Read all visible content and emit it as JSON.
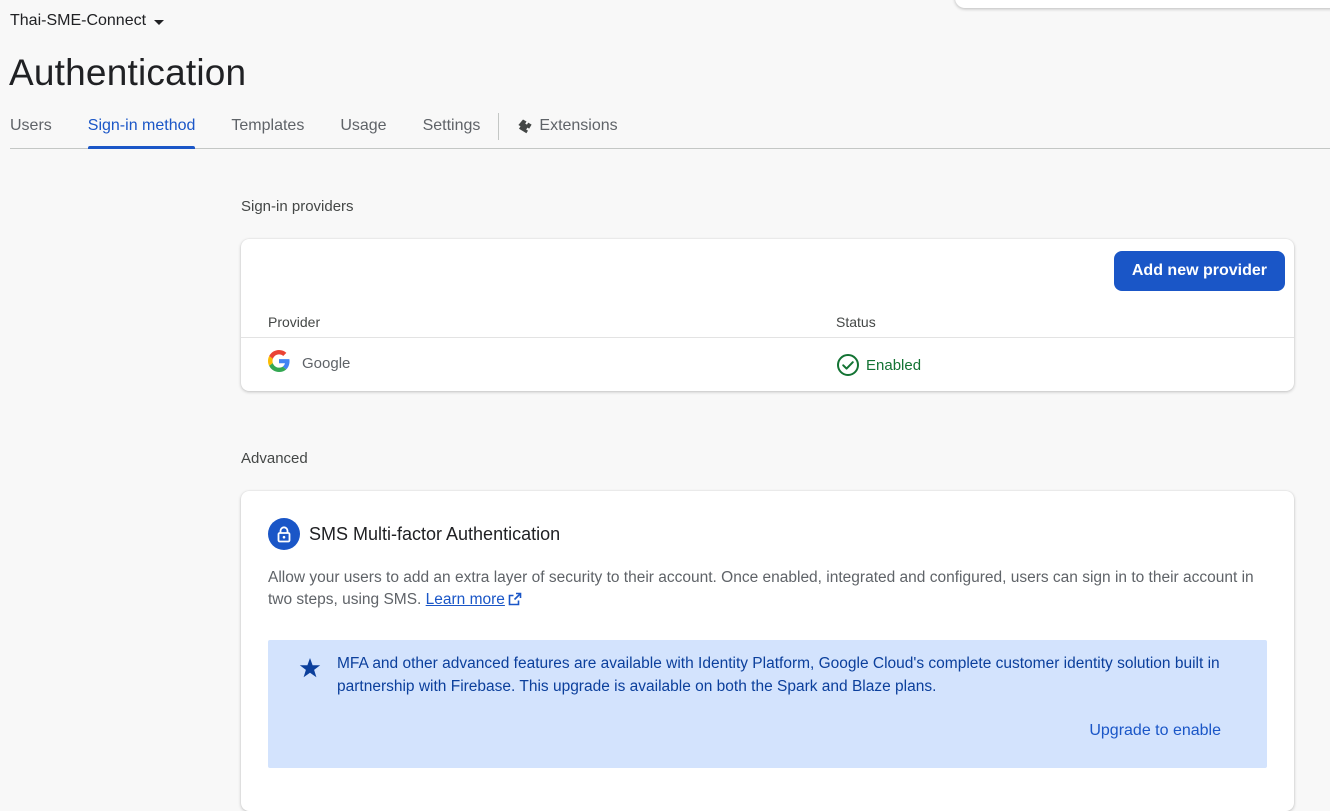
{
  "project": {
    "name": "Thai-SME-Connect"
  },
  "page": {
    "title": "Authentication"
  },
  "tabs": [
    {
      "label": "Users"
    },
    {
      "label": "Sign-in method"
    },
    {
      "label": "Templates"
    },
    {
      "label": "Usage"
    },
    {
      "label": "Settings"
    },
    {
      "label": "Extensions",
      "icon": "extension-icon"
    }
  ],
  "active_tab": "Sign-in method",
  "sign_in_providers": {
    "section_label": "Sign-in providers",
    "add_button": "Add new provider",
    "columns": {
      "provider": "Provider",
      "status": "Status"
    },
    "rows": [
      {
        "provider": "Google",
        "icon": "google-logo",
        "status": "Enabled",
        "status_icon": "check-circle-icon"
      }
    ]
  },
  "advanced": {
    "section_label": "Advanced",
    "mfa": {
      "icon": "lock-icon",
      "title": "SMS Multi-factor Authentication",
      "description": "Allow your users to add an extra layer of security to their account. Once enabled, integrated and configured, users can sign in to their account in two steps, using SMS.",
      "learn_more": "Learn more",
      "banner_text": "MFA and other advanced features are available with Identity Platform, Google Cloud's complete customer identity solution built in partnership with Firebase. This upgrade is available on both the Spark and Blaze plans.",
      "upgrade_link": "Upgrade to enable"
    }
  },
  "colors": {
    "accent": "#1a56c7",
    "enabled_green": "#137333",
    "banner_bg": "#d3e3fd",
    "banner_text": "#0b3f9c"
  }
}
